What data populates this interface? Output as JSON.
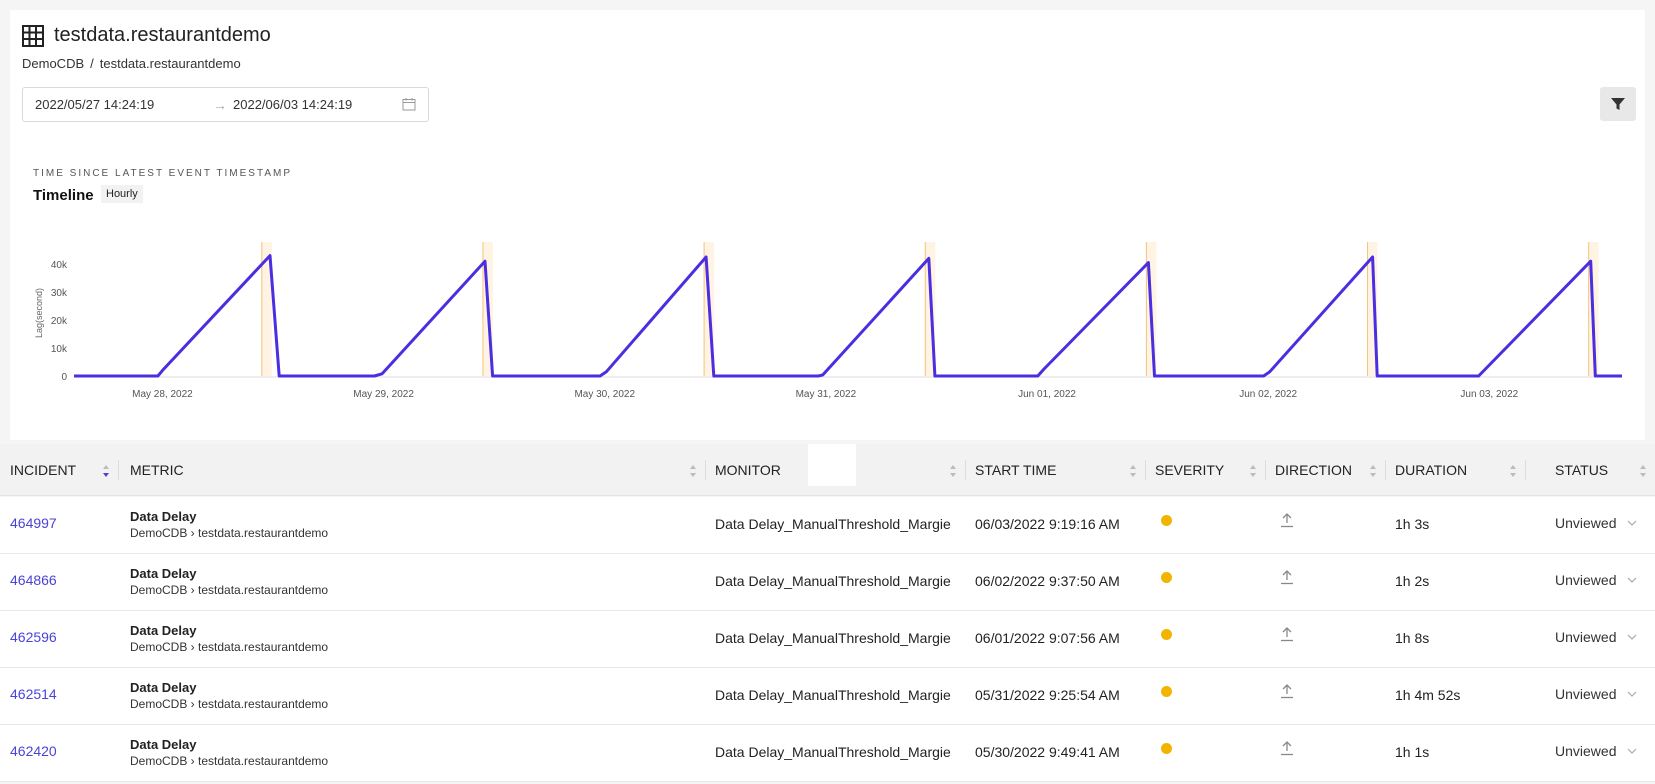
{
  "header": {
    "title": "testdata.restaurantdemo",
    "breadcrumb": [
      "DemoCDB",
      "/",
      "testdata.restaurantdemo"
    ]
  },
  "date_range": {
    "start": "2022/05/27 14:24:19",
    "arrow": "→",
    "end": "2022/06/03 14:24:19"
  },
  "section": {
    "label": "TIME SINCE LATEST EVENT TIMESTAMP",
    "title": "Timeline",
    "granularity": "Hourly"
  },
  "chart_data": {
    "type": "line",
    "ylabel": "Lag(second)",
    "yticks": [
      "0",
      "10k",
      "20k",
      "30k",
      "40k"
    ],
    "ylim": [
      0,
      45000
    ],
    "xticks": [
      "May 28, 2022",
      "May 29, 2022",
      "May 30, 2022",
      "May 31, 2022",
      "Jun 01, 2022",
      "Jun 02, 2022",
      "Jun 03, 2022"
    ],
    "series": [
      {
        "color": "#4a2ee0",
        "points": [
          {
            "x": "2022-05-27 14:24",
            "y": 0
          },
          {
            "x": "2022-05-27 23:30",
            "y": 0
          },
          {
            "x": "2022-05-28 00:00",
            "y": 2000
          },
          {
            "x": "2022-05-28 11:40",
            "y": 43000
          },
          {
            "x": "2022-05-28 12:40",
            "y": 0
          },
          {
            "x": "2022-05-28 23:00",
            "y": 0
          },
          {
            "x": "2022-05-28 23:50",
            "y": 800
          },
          {
            "x": "2022-05-29 11:00",
            "y": 41000
          },
          {
            "x": "2022-05-29 11:50",
            "y": 0
          },
          {
            "x": "2022-05-29 23:30",
            "y": 0
          },
          {
            "x": "2022-05-30 00:10",
            "y": 1500
          },
          {
            "x": "2022-05-30 11:00",
            "y": 42500
          },
          {
            "x": "2022-05-30 11:50",
            "y": 0
          },
          {
            "x": "2022-05-30 23:10",
            "y": 0
          },
          {
            "x": "2022-05-30 23:40",
            "y": 400
          },
          {
            "x": "2022-05-31 11:10",
            "y": 42000
          },
          {
            "x": "2022-05-31 11:50",
            "y": 0
          },
          {
            "x": "2022-05-31 23:00",
            "y": 0
          },
          {
            "x": "2022-05-31 23:40",
            "y": 2500
          },
          {
            "x": "2022-06-01 11:00",
            "y": 40500
          },
          {
            "x": "2022-06-01 11:40",
            "y": 0
          },
          {
            "x": "2022-06-01 23:30",
            "y": 0
          },
          {
            "x": "2022-06-02 00:10",
            "y": 1500
          },
          {
            "x": "2022-06-02 11:20",
            "y": 42500
          },
          {
            "x": "2022-06-02 11:50",
            "y": 0
          },
          {
            "x": "2022-06-02 22:50",
            "y": 0
          },
          {
            "x": "2022-06-03 11:00",
            "y": 41000
          },
          {
            "x": "2022-06-03 11:30",
            "y": 0
          },
          {
            "x": "2022-06-03 14:24",
            "y": 0
          }
        ]
      }
    ],
    "incident_markers": [
      "2022-05-28 11:00",
      "2022-05-29 11:00",
      "2022-05-30 11:00",
      "2022-05-31 11:00",
      "2022-06-01 11:00",
      "2022-06-02 11:00",
      "2022-06-03 11:00"
    ],
    "marker_color": "#f5c27a",
    "grid": false
  },
  "table": {
    "columns": [
      "INCIDENT",
      "METRIC",
      "MONITOR",
      "START TIME",
      "SEVERITY",
      "DIRECTION",
      "DURATION",
      "STATUS"
    ],
    "rows": [
      {
        "incident": "464997",
        "metric": "Data Delay",
        "path": "DemoCDB › testdata.restaurantdemo",
        "monitor": "Data Delay_ManualThreshold_Margie",
        "start": "06/03/2022 9:19:16 AM",
        "duration": "1h 3s",
        "status": "Unviewed"
      },
      {
        "incident": "464866",
        "metric": "Data Delay",
        "path": "DemoCDB › testdata.restaurantdemo",
        "monitor": "Data Delay_ManualThreshold_Margie",
        "start": "06/02/2022 9:37:50 AM",
        "duration": "1h 2s",
        "status": "Unviewed"
      },
      {
        "incident": "462596",
        "metric": "Data Delay",
        "path": "DemoCDB › testdata.restaurantdemo",
        "monitor": "Data Delay_ManualThreshold_Margie",
        "start": "06/01/2022 9:07:56 AM",
        "duration": "1h 8s",
        "status": "Unviewed"
      },
      {
        "incident": "462514",
        "metric": "Data Delay",
        "path": "DemoCDB › testdata.restaurantdemo",
        "monitor": "Data Delay_ManualThreshold_Margie",
        "start": "05/31/2022 9:25:54 AM",
        "duration": "1h 4m 52s",
        "status": "Unviewed"
      },
      {
        "incident": "462420",
        "metric": "Data Delay",
        "path": "DemoCDB › testdata.restaurantdemo",
        "monitor": "Data Delay_ManualThreshold_Margie",
        "start": "05/30/2022 9:49:41 AM",
        "duration": "1h 1s",
        "status": "Unviewed"
      }
    ],
    "severity_color": "#f2b400",
    "direction_icon": "upload-arrow-icon"
  },
  "colors": {
    "accent": "#4a43d8",
    "line": "#4a2ee0"
  }
}
